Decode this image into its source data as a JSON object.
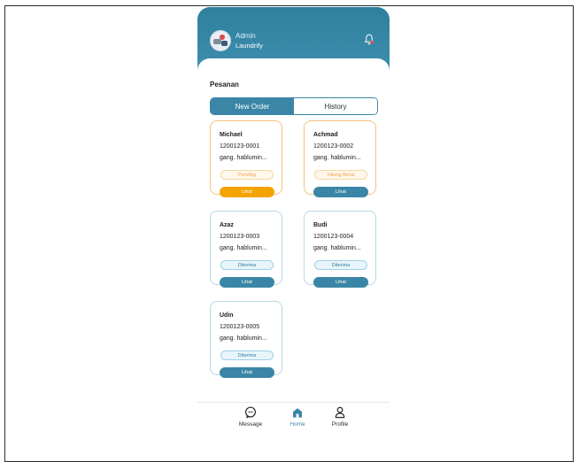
{
  "header": {
    "role": "Admin",
    "name": "Laundrify",
    "avatar_icon": "user-avatar-icon",
    "notification_icon": "bell-icon"
  },
  "main": {
    "section_title": "Pesanan",
    "tabs": [
      {
        "label": "New Order",
        "active": true
      },
      {
        "label": "History",
        "active": false
      }
    ],
    "orders": [
      {
        "name": "Michael",
        "code": "1200123-0001",
        "address": "gang. hablumin...",
        "status": "Pending",
        "button": "Lihat"
      },
      {
        "name": "Achmad",
        "code": "1200123-0002",
        "address": "gang. hablumin...",
        "status": "Hitung Berat",
        "button": "Lihat"
      },
      {
        "name": "Azaz",
        "code": "1200123-0003",
        "address": "gang. hablumin...",
        "status": "Diterima",
        "button": "Lihat"
      },
      {
        "name": "Budi",
        "code": "1200123-0004",
        "address": "gang. hablumin...",
        "status": "Diterima",
        "button": "Lihat"
      },
      {
        "name": "Udin",
        "code": "1200123-0005",
        "address": "gang. hablumin...",
        "status": "Diterima",
        "button": "Lihat"
      }
    ]
  },
  "bottom_nav": [
    {
      "label": "Message",
      "icon": "message-icon",
      "active": false
    },
    {
      "label": "Home",
      "icon": "home-icon",
      "active": true
    },
    {
      "label": "Profile",
      "icon": "profile-icon",
      "active": false
    }
  ],
  "colors": {
    "primary": "#3b86a6",
    "header": "#2f7f9e",
    "pending": "#f5a300",
    "accepted_badge": "#e8f5fb"
  }
}
